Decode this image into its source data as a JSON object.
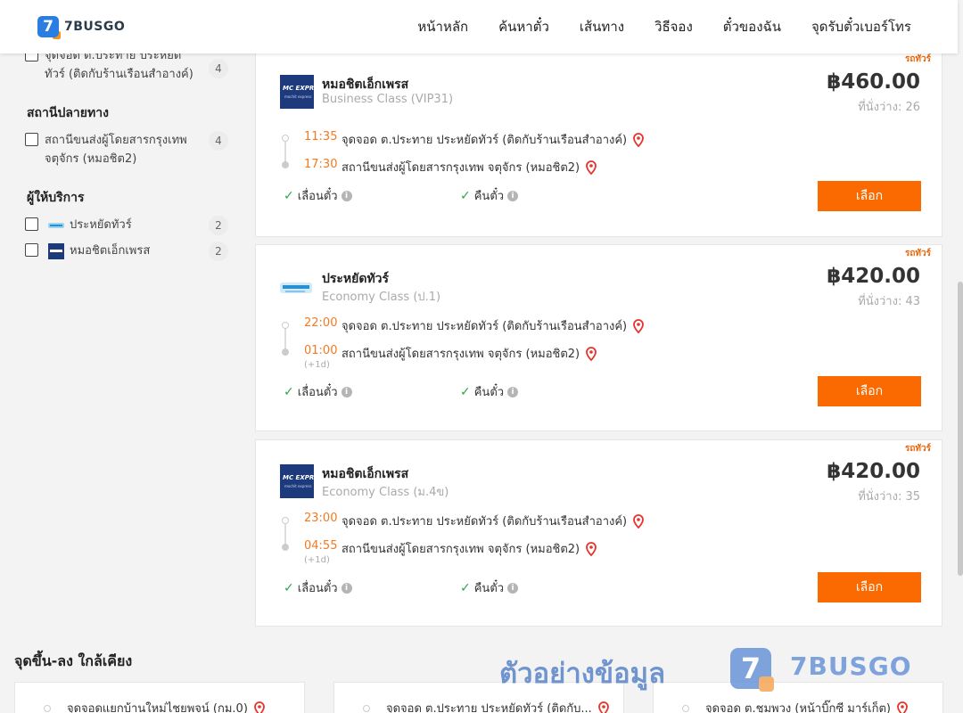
{
  "brand": "7BUSGO",
  "nav": [
    "หน้าหลัก",
    "ค้นหาตั๋ว",
    "เส้นทาง",
    "วิธีจอง",
    "ตั๋วของฉัน",
    "จุดรับตั๋วเบอร์โทร"
  ],
  "sidebar": {
    "origin_item": {
      "label": "จุดจอด ต.ประทาย ประหยัดทัวร์ (ติดกับร้านเรือนสำอางค์)",
      "count": "4"
    },
    "destination_heading": "สถานีปลายทาง",
    "destination_item": {
      "label": "สถานีขนส่งผู้โดยสารกรุงเทพ จตุจักร (หมอชิต2)",
      "count": "4"
    },
    "operator_heading": "ผู้ให้บริการ",
    "operators": [
      {
        "label": "ประหยัดทัวร์",
        "count": "2",
        "icon": "prayat-tour-logo"
      },
      {
        "label": "หมอชิตเอ็กเพรส",
        "count": "2",
        "icon": "mc-express-logo"
      }
    ]
  },
  "trips": [
    {
      "badge": "รถทัวร์",
      "operator": "หมอชิตเอ็กเพรส",
      "operator_logo": "mc-express-logo",
      "logo_text": "MC EXPRESS",
      "logo_sub": "mochit express",
      "class": "Business Class (VIP31)",
      "price": "฿460.00",
      "seats": "ที่นั่งว่าง: 26",
      "depart_time": "11:35",
      "depart_place": "จุดจอด ต.ประทาย ประหยัดทัวร์ (ติดกับร้านเรือนสำอางค์)",
      "arrive_time": "17:30",
      "arrive_place": "สถานีขนส่งผู้โดยสารกรุงเทพ จตุจักร (หมอชิต2)",
      "next_day": "",
      "policy1": "เลื่อนตั๋ว",
      "policy2": "คืนตั๋ว",
      "button": "เลือก"
    },
    {
      "badge": "รถทัวร์",
      "operator": "ประหยัดทัวร์",
      "operator_logo": "prayat-tour-logo",
      "logo_text": "",
      "logo_sub": "",
      "class": "Economy Class (ป.1)",
      "price": "฿420.00",
      "seats": "ที่นั่งว่าง: 43",
      "depart_time": "22:00",
      "depart_place": "จุดจอด ต.ประทาย ประหยัดทัวร์ (ติดกับร้านเรือนสำอางค์)",
      "arrive_time": "01:00",
      "arrive_place": "สถานีขนส่งผู้โดยสารกรุงเทพ จตุจักร (หมอชิต2)",
      "next_day": "(+1d)",
      "policy1": "เลื่อนตั๋ว",
      "policy2": "คืนตั๋ว",
      "button": "เลือก"
    },
    {
      "badge": "รถทัวร์",
      "operator": "หมอชิตเอ็กเพรส",
      "operator_logo": "mc-express-logo",
      "logo_text": "MC EXPRESS",
      "logo_sub": "mochit express",
      "class": "Economy Class (ม.4ข)",
      "price": "฿420.00",
      "seats": "ที่นั่งว่าง: 35",
      "depart_time": "23:00",
      "depart_place": "จุดจอด ต.ประทาย ประหยัดทัวร์ (ติดกับร้านเรือนสำอางค์)",
      "arrive_time": "04:55",
      "arrive_place": "สถานีขนส่งผู้โดยสารกรุงเทพ จตุจักร (หมอชิต2)",
      "next_day": "(+1d)",
      "policy1": "เลื่อนตั๋ว",
      "policy2": "คืนตั๋ว",
      "button": "เลือก"
    }
  ],
  "nearby": {
    "title": "จุดขึ้น-ลง ใกล้เคียง",
    "items": [
      "จุดจอดแยกบ้านใหม่ไชยพจน์ (กม.0)",
      "จุดจอด ต.ประทาย ประหยัดทัวร์ (ติดกับ...",
      "จุดจอด ต.ชุมพวง (หน้าบิ๊กซี มาร์เก็ต)"
    ]
  },
  "watermark": {
    "text": "ตัวอย่างข้อมูล",
    "brand": "7BUSGO",
    "mark": "7"
  },
  "colors": {
    "accent": "#fb6a00",
    "time": "#f47920",
    "check": "#2aa84a",
    "pin": "#e8322b",
    "brand_blue": "#2a7de1"
  }
}
